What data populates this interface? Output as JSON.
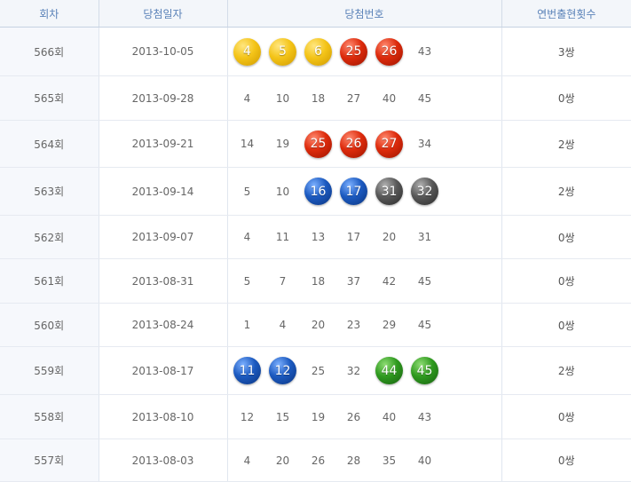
{
  "columns": [
    "회차",
    "당첨일자",
    "당첨번호",
    "연번출현횟수"
  ],
  "ball_colors": {
    "yellow": "#f4c418",
    "red": "#dd2b0c",
    "blue": "#1c5ac0",
    "gray": "#585858",
    "green": "#2f9a1f"
  },
  "rows": [
    {
      "round": "566회",
      "date": "2013-10-05",
      "pairs": "3쌍",
      "numbers": [
        {
          "v": "4",
          "ball": "yellow"
        },
        {
          "v": "5",
          "ball": "yellow"
        },
        {
          "v": "6",
          "ball": "yellow"
        },
        {
          "v": "25",
          "ball": "red"
        },
        {
          "v": "26",
          "ball": "red"
        },
        {
          "v": "43",
          "ball": ""
        }
      ]
    },
    {
      "round": "565회",
      "date": "2013-09-28",
      "pairs": "0쌍",
      "numbers": [
        {
          "v": "4",
          "ball": ""
        },
        {
          "v": "10",
          "ball": ""
        },
        {
          "v": "18",
          "ball": ""
        },
        {
          "v": "27",
          "ball": ""
        },
        {
          "v": "40",
          "ball": ""
        },
        {
          "v": "45",
          "ball": ""
        }
      ]
    },
    {
      "round": "564회",
      "date": "2013-09-21",
      "pairs": "2쌍",
      "numbers": [
        {
          "v": "14",
          "ball": ""
        },
        {
          "v": "19",
          "ball": ""
        },
        {
          "v": "25",
          "ball": "red"
        },
        {
          "v": "26",
          "ball": "red"
        },
        {
          "v": "27",
          "ball": "red"
        },
        {
          "v": "34",
          "ball": ""
        }
      ]
    },
    {
      "round": "563회",
      "date": "2013-09-14",
      "pairs": "2쌍",
      "numbers": [
        {
          "v": "5",
          "ball": ""
        },
        {
          "v": "10",
          "ball": ""
        },
        {
          "v": "16",
          "ball": "blue"
        },
        {
          "v": "17",
          "ball": "blue"
        },
        {
          "v": "31",
          "ball": "gray"
        },
        {
          "v": "32",
          "ball": "gray"
        }
      ]
    },
    {
      "round": "562회",
      "date": "2013-09-07",
      "pairs": "0쌍",
      "numbers": [
        {
          "v": "4",
          "ball": ""
        },
        {
          "v": "11",
          "ball": ""
        },
        {
          "v": "13",
          "ball": ""
        },
        {
          "v": "17",
          "ball": ""
        },
        {
          "v": "20",
          "ball": ""
        },
        {
          "v": "31",
          "ball": ""
        }
      ]
    },
    {
      "round": "561회",
      "date": "2013-08-31",
      "pairs": "0쌍",
      "numbers": [
        {
          "v": "5",
          "ball": ""
        },
        {
          "v": "7",
          "ball": ""
        },
        {
          "v": "18",
          "ball": ""
        },
        {
          "v": "37",
          "ball": ""
        },
        {
          "v": "42",
          "ball": ""
        },
        {
          "v": "45",
          "ball": ""
        }
      ]
    },
    {
      "round": "560회",
      "date": "2013-08-24",
      "pairs": "0쌍",
      "numbers": [
        {
          "v": "1",
          "ball": ""
        },
        {
          "v": "4",
          "ball": ""
        },
        {
          "v": "20",
          "ball": ""
        },
        {
          "v": "23",
          "ball": ""
        },
        {
          "v": "29",
          "ball": ""
        },
        {
          "v": "45",
          "ball": ""
        }
      ]
    },
    {
      "round": "559회",
      "date": "2013-08-17",
      "pairs": "2쌍",
      "numbers": [
        {
          "v": "11",
          "ball": "blue"
        },
        {
          "v": "12",
          "ball": "blue"
        },
        {
          "v": "25",
          "ball": ""
        },
        {
          "v": "32",
          "ball": ""
        },
        {
          "v": "44",
          "ball": "green"
        },
        {
          "v": "45",
          "ball": "green"
        }
      ]
    },
    {
      "round": "558회",
      "date": "2013-08-10",
      "pairs": "0쌍",
      "numbers": [
        {
          "v": "12",
          "ball": ""
        },
        {
          "v": "15",
          "ball": ""
        },
        {
          "v": "19",
          "ball": ""
        },
        {
          "v": "26",
          "ball": ""
        },
        {
          "v": "40",
          "ball": ""
        },
        {
          "v": "43",
          "ball": ""
        }
      ]
    },
    {
      "round": "557회",
      "date": "2013-08-03",
      "pairs": "0쌍",
      "numbers": [
        {
          "v": "4",
          "ball": ""
        },
        {
          "v": "20",
          "ball": ""
        },
        {
          "v": "26",
          "ball": ""
        },
        {
          "v": "28",
          "ball": ""
        },
        {
          "v": "35",
          "ball": ""
        },
        {
          "v": "40",
          "ball": ""
        }
      ]
    }
  ]
}
